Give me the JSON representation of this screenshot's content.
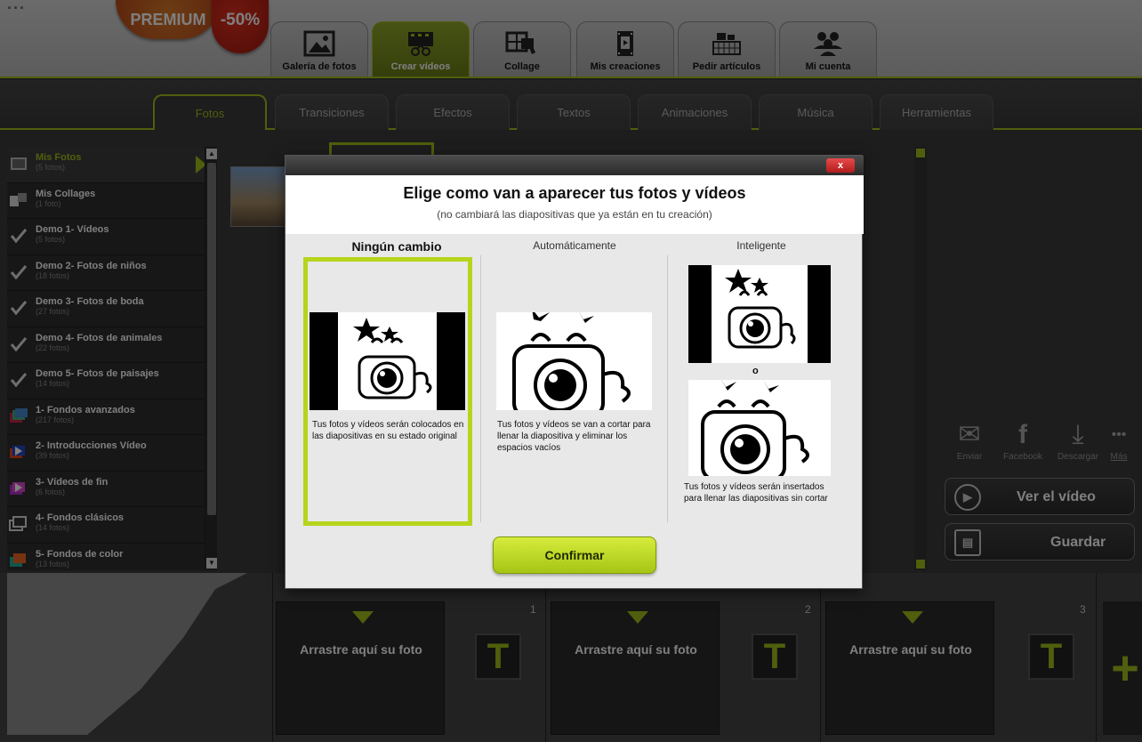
{
  "header": {
    "logo_fragment": "...",
    "premium_label": "PREMIUM",
    "discount_label": "-50%",
    "main_tabs": [
      {
        "label": "Galería de fotos",
        "icon": "picture-icon"
      },
      {
        "label": "Crear vídeos",
        "icon": "film-scissors-icon"
      },
      {
        "label": "Collage",
        "icon": "collage-icon"
      },
      {
        "label": "Mis creaciones",
        "icon": "film-icon"
      },
      {
        "label": "Pedir artículos",
        "icon": "basket-icon"
      },
      {
        "label": "Mi cuenta",
        "icon": "users-icon"
      }
    ],
    "active_main_tab": "Crear vídeos"
  },
  "subtabs": [
    "Fotos",
    "Transiciones",
    "Efectos",
    "Textos",
    "Animaciones",
    "Música",
    "Herramientas"
  ],
  "active_subtab": "Fotos",
  "sidebar": {
    "items": [
      {
        "title": "Mis Fotos",
        "count": "(5 fotos)"
      },
      {
        "title": "Mis Collages",
        "count": "(1 foto)"
      },
      {
        "title": "Demo 1- Vídeos",
        "count": "(5 fotos)"
      },
      {
        "title": "Demo 2- Fotos de niños",
        "count": "(18 fotos)"
      },
      {
        "title": "Demo 3- Fotos de boda",
        "count": "(27 fotos)"
      },
      {
        "title": "Demo 4- Fotos de animales",
        "count": "(22 fotos)"
      },
      {
        "title": "Demo 5- Fotos de paisajes",
        "count": "(14 fotos)"
      },
      {
        "title": "1- Fondos avanzados",
        "count": "(217 fotos)"
      },
      {
        "title": "2- Introducciones Vídeo",
        "count": "(39 fotos)"
      },
      {
        "title": "3- Vídeos de fin",
        "count": "(6 fotos)"
      },
      {
        "title": "4- Fondos clásicos",
        "count": "(14 fotos)"
      },
      {
        "title": "5- Fondos de color",
        "count": "(13 fotos)"
      }
    ]
  },
  "modal": {
    "title": "Elige como van a aparecer tus fotos y vídeos",
    "subtitle": "(no cambiará las diapositivas que ya están en tu creación)",
    "close_label": "x",
    "options": [
      {
        "title": "Ningún cambio",
        "description": "Tus fotos y vídeos serán colocados en las diapositivas en su estado original",
        "selected": true
      },
      {
        "title": "Automáticamente",
        "description": "Tus fotos y vídeos se van a cortar para llenar la diapositiva y eliminar los espacios vacíos",
        "selected": false
      },
      {
        "title": "Inteligente",
        "description": "Tus fotos y vídeos serán insertados para llenar las diapositivas sin cortar",
        "selected": false
      }
    ],
    "or_label": "o",
    "confirm_label": "Confirmar"
  },
  "share": {
    "items": [
      {
        "label": "Enviar",
        "icon": "email-icon"
      },
      {
        "label": "Facebook",
        "icon": "facebook-icon"
      },
      {
        "label": "Descargar",
        "icon": "download-icon"
      },
      {
        "label": "Más",
        "icon": "more-icon"
      }
    ]
  },
  "actions": {
    "play_label": "Ver el vídeo",
    "save_label": "Guardar"
  },
  "timeline": {
    "slots": [
      {
        "label": "Arrastre aquí su foto",
        "number": "1"
      },
      {
        "label": "Arrastre aquí su foto",
        "number": "2"
      },
      {
        "label": "Arrastre aquí su foto",
        "number": "3"
      }
    ],
    "text_button_label": "T",
    "add_button_label": "+"
  },
  "colors": {
    "accent": "#9fbf1a",
    "selection": "#b7d41c",
    "close": "#d02a2a"
  }
}
